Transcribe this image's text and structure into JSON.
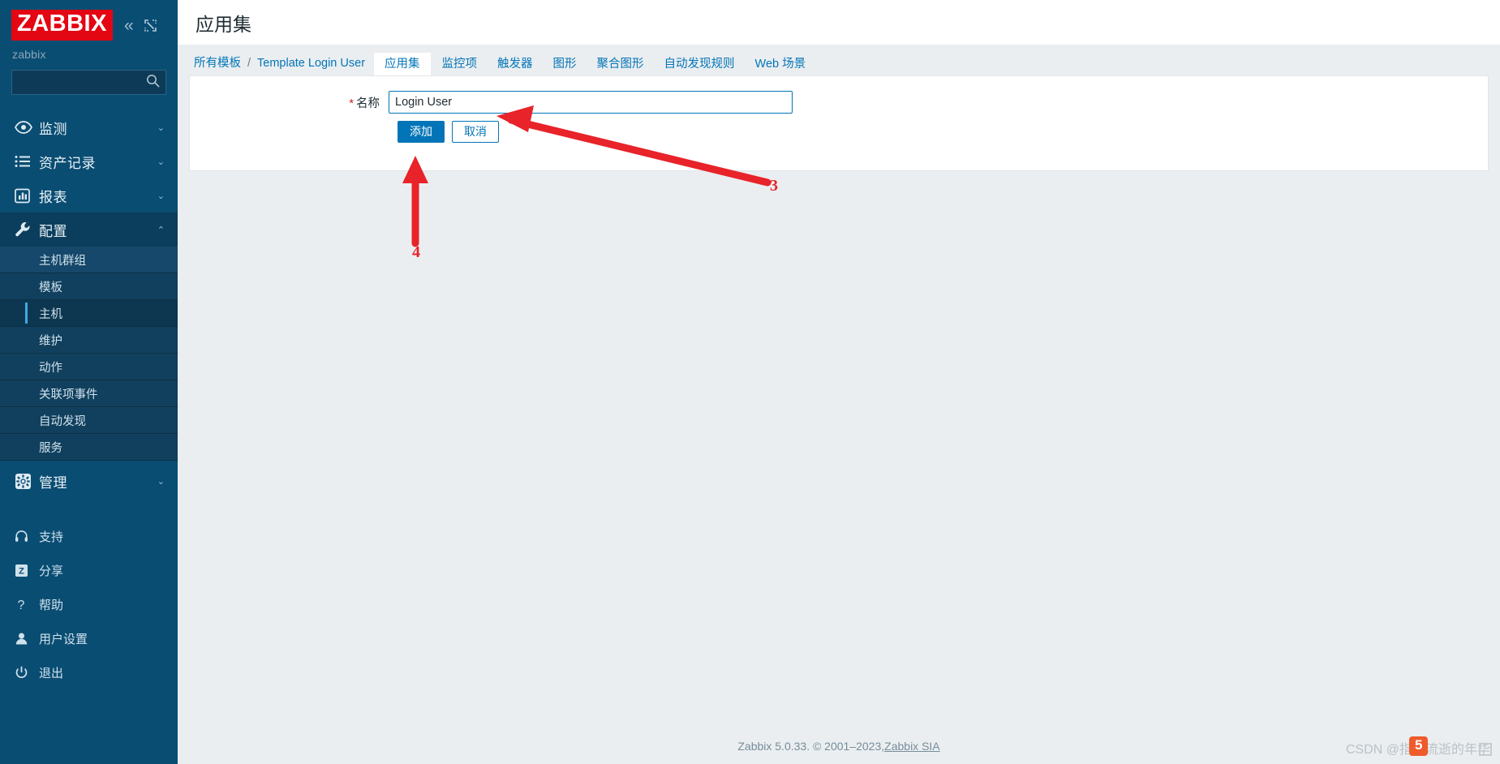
{
  "sidebar": {
    "logo_text": "ZABBIX",
    "collapse_icon": "chevron-double-left-icon",
    "fullscreen_icon": "expand-icon",
    "server_name": "zabbix",
    "search_placeholder": "",
    "search_value": "",
    "nav": [
      {
        "label": "监测",
        "icon": "eye-icon",
        "expanded": false,
        "arrow": "⌄"
      },
      {
        "label": "资产记录",
        "icon": "list-icon",
        "expanded": false,
        "arrow": "⌄"
      },
      {
        "label": "报表",
        "icon": "chart-bar-icon",
        "expanded": false,
        "arrow": "⌄"
      },
      {
        "label": "配置",
        "icon": "wrench-icon",
        "expanded": true,
        "arrow": "⌃"
      }
    ],
    "config_submenu": [
      {
        "label": "主机群组",
        "state": "hover"
      },
      {
        "label": "模板",
        "state": "normal"
      },
      {
        "label": "主机",
        "state": "selected"
      },
      {
        "label": "维护",
        "state": "normal"
      },
      {
        "label": "动作",
        "state": "normal"
      },
      {
        "label": "关联项事件",
        "state": "normal"
      },
      {
        "label": "自动发现",
        "state": "normal"
      },
      {
        "label": "服务",
        "state": "normal"
      }
    ],
    "nav_admin": {
      "label": "管理",
      "icon": "gear-icon",
      "arrow": "⌄"
    },
    "bottom": [
      {
        "label": "支持",
        "icon": "headset-icon"
      },
      {
        "label": "分享",
        "icon": "zabbix-z-icon"
      },
      {
        "label": "帮助",
        "icon": "question-icon"
      },
      {
        "label": "用户设置",
        "icon": "user-icon"
      },
      {
        "label": "退出",
        "icon": "power-icon"
      }
    ]
  },
  "header": {
    "title": "应用集"
  },
  "breadcrumb": {
    "root": "所有模板",
    "separator": "/",
    "template": "Template Login User"
  },
  "tabs": [
    {
      "label": "应用集",
      "active": true
    },
    {
      "label": "监控项",
      "active": false
    },
    {
      "label": "触发器",
      "active": false
    },
    {
      "label": "图形",
      "active": false
    },
    {
      "label": "聚合图形",
      "active": false
    },
    {
      "label": "自动发现规则",
      "active": false
    },
    {
      "label": "Web 场景",
      "active": false
    }
  ],
  "form": {
    "required_marker": "*",
    "name_label": "名称",
    "name_value": "Login User",
    "name_placeholder": "",
    "submit_label": "添加",
    "cancel_label": "取消"
  },
  "annotations": [
    {
      "id": "3",
      "target": "name-input"
    },
    {
      "id": "4",
      "target": "submit-button"
    }
  ],
  "footer": {
    "text": "Zabbix 5.0.33. © 2001–2023, ",
    "link": "Zabbix SIA"
  },
  "watermark": {
    "text": "CSDN @指尖流逝的年华",
    "badge": "5"
  },
  "colors": {
    "sidebar_bg": "#0a4d73",
    "accent": "#0275b8",
    "logo_red": "#e30613",
    "annotation_red": "#e8232a",
    "required_red": "#d11d1d"
  }
}
